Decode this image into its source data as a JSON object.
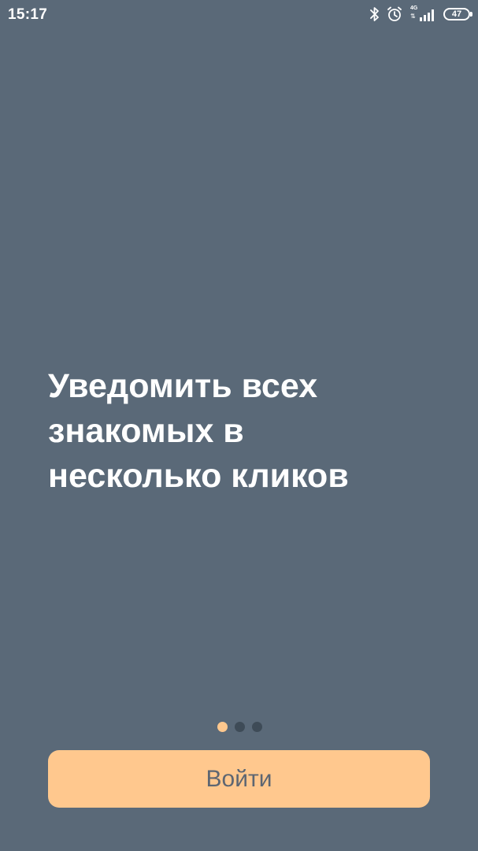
{
  "status_bar": {
    "time": "15:17",
    "network_type": "4G",
    "network_arrows": "⇅",
    "battery_level": "47",
    "icons": [
      "bluetooth-icon",
      "alarm-icon",
      "signal-icon",
      "battery-icon"
    ]
  },
  "onboarding": {
    "headline_lines": [
      "Уведомить всех",
      "знакомых в",
      "несколько кликов"
    ],
    "pager": {
      "total_pages": 3,
      "active_index": 0
    }
  },
  "login_button": {
    "label": "Войти"
  },
  "colors": {
    "background": "#5a6978",
    "accent": "#ffc88e",
    "dot_inactive": "#3e4b57",
    "button_text": "#5d6672",
    "text": "#ffffff"
  }
}
